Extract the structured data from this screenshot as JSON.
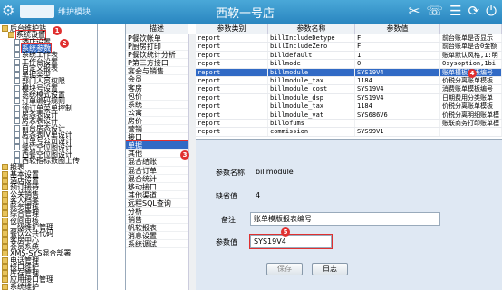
{
  "app": {
    "title": "西软一号店",
    "maint_label": "维护模块"
  },
  "colors": {
    "accent": "#2a86c0",
    "selection": "#316ac5",
    "annotation": "#e03030",
    "form_bg": "#dfe8f3"
  },
  "tree": {
    "items": [
      {
        "label": "后台维护站",
        "indent": 0,
        "kind": "folder"
      },
      {
        "label": "系统设置",
        "indent": 1,
        "kind": "folder"
      },
      {
        "label": "酒店设置",
        "indent": 2,
        "kind": "leaf"
      },
      {
        "label": "系统参数",
        "indent": 2,
        "kind": "leaf",
        "selected": true
      },
      {
        "label": "系统工作表",
        "indent": 2,
        "kind": "leaf"
      },
      {
        "label": "工作台设置",
        "indent": 2,
        "kind": "leaf"
      },
      {
        "label": "自定义报表",
        "indent": 2,
        "kind": "leaf"
      },
      {
        "label": "单据类型",
        "indent": 2,
        "kind": "leaf"
      },
      {
        "label": "部门人员权限",
        "indent": 2,
        "kind": "leaf"
      },
      {
        "label": "模块号设置",
        "indent": 2,
        "kind": "leaf"
      },
      {
        "label": "系统模式设置",
        "indent": 2,
        "kind": "leaf"
      },
      {
        "label": "订单编码规则",
        "indent": 2,
        "kind": "leaf"
      },
      {
        "label": "预订单菜单控制",
        "indent": 2,
        "kind": "leaf"
      },
      {
        "label": "房态表设计",
        "indent": 2,
        "kind": "leaf"
      },
      {
        "label": "房态表设计",
        "indent": 2,
        "kind": "leaf"
      },
      {
        "label": "前台房态设计",
        "indent": 2,
        "kind": "leaf"
      },
      {
        "label": "房态表IV单设计",
        "indent": 2,
        "kind": "leaf"
      },
      {
        "label": "订单号公司设计",
        "indent": 2,
        "kind": "leaf"
      },
      {
        "label": "餐饮空位图设计",
        "indent": 2,
        "kind": "leaf"
      },
      {
        "label": "西餐空位图设计",
        "indent": 2,
        "kind": "leaf"
      },
      {
        "label": "西软指标数图上传",
        "indent": 2,
        "kind": "leaf"
      },
      {
        "label": "报表",
        "indent": 0,
        "kind": "folder"
      },
      {
        "label": "基本设置",
        "indent": 0,
        "kind": "folder"
      },
      {
        "label": "酒店设置",
        "indent": 0,
        "kind": "folder"
      },
      {
        "label": "预订接待",
        "indent": 0,
        "kind": "folder"
      },
      {
        "label": "公关销售",
        "indent": 0,
        "kind": "folder"
      },
      {
        "label": "客人档案",
        "indent": 0,
        "kind": "folder"
      },
      {
        "label": "账务审核",
        "indent": 0,
        "kind": "folder"
      },
      {
        "label": "综合管理",
        "indent": 0,
        "kind": "folder"
      },
      {
        "label": "夜间审核",
        "indent": 0,
        "kind": "folder"
      },
      {
        "label": "二级维护管理",
        "indent": 0,
        "kind": "folder"
      },
      {
        "label": "餐饮公共代码",
        "indent": 0,
        "kind": "folder"
      },
      {
        "label": "客房中心",
        "indent": 0,
        "kind": "folder"
      },
      {
        "label": "会员系统",
        "indent": 0,
        "kind": "folder"
      },
      {
        "label": "XMS-SYS混合部署",
        "indent": 0,
        "kind": "folder"
      },
      {
        "label": "电话管理",
        "indent": 0,
        "kind": "folder"
      },
      {
        "label": "接口维护",
        "indent": 0,
        "kind": "folder"
      },
      {
        "label": "库存管理",
        "indent": 0,
        "kind": "folder"
      },
      {
        "label": "应用接口管理",
        "indent": 0,
        "kind": "folder"
      },
      {
        "label": "系统维护",
        "indent": 0,
        "kind": "folder"
      }
    ]
  },
  "categories": {
    "header": "描述",
    "items": [
      "P餐饮帐单",
      "P厨房打印",
      "P餐饮统计分析",
      "P第三方接口",
      "宴会与销售",
      "会员",
      "客房",
      "包价",
      "系统",
      "公寓",
      "房价",
      "营销",
      "接口",
      "单据",
      "其他",
      "混合结账",
      "混合订单",
      "混合统计",
      "移动接口",
      "其他渠道",
      "远程SQL查询",
      "分析",
      "销售",
      "帆软报表",
      "消息设置",
      "系统调试"
    ],
    "selected_index": 13
  },
  "grid": {
    "headers": [
      "参数类别",
      "参数名称",
      "参数值",
      ""
    ],
    "rows": [
      [
        "report",
        "billIncludeDetype",
        "F",
        "前台账单是否显示"
      ],
      [
        "report",
        "billIncludeZero",
        "F",
        "前台账单是否0金额"
      ],
      [
        "report",
        "billdefault",
        "1",
        "账单默认风格,1:明"
      ],
      [
        "report",
        "billmode",
        "0",
        "0sysoption,1bi"
      ],
      [
        "report",
        "billmodule",
        "SYS19V4",
        "账单模板报表编号"
      ],
      [
        "report",
        "billmodule_tax",
        "1184",
        "价税分离账单模板"
      ],
      [
        "report",
        "billmodule_cost",
        "SYS19V4",
        "消费账单模板编号"
      ],
      [
        "report",
        "billmodule_dsp",
        "SYS19V4",
        "日期费用分类账单"
      ],
      [
        "report",
        "billmodule_tax",
        "1184",
        "价税分离账单模板"
      ],
      [
        "report",
        "billmodule_vat",
        "SYS686V6",
        "价税分离明细账单模"
      ],
      [
        "report",
        "billofums",
        "",
        "账联商务打印账单模"
      ],
      [
        "report",
        "commission",
        "SYS99V1",
        ""
      ]
    ],
    "selected_index": 4
  },
  "form": {
    "name_label": "参数名称",
    "name_value": "billmodule",
    "default_label": "缺省值",
    "default_value": "4",
    "note_label": "备注",
    "note_value": "账单模版报表编号",
    "value_label": "参数值",
    "value_value": "SYS19V4",
    "save_label": "保存",
    "log_label": "日志"
  },
  "badges": [
    "1",
    "2",
    "3",
    "4",
    "5"
  ]
}
